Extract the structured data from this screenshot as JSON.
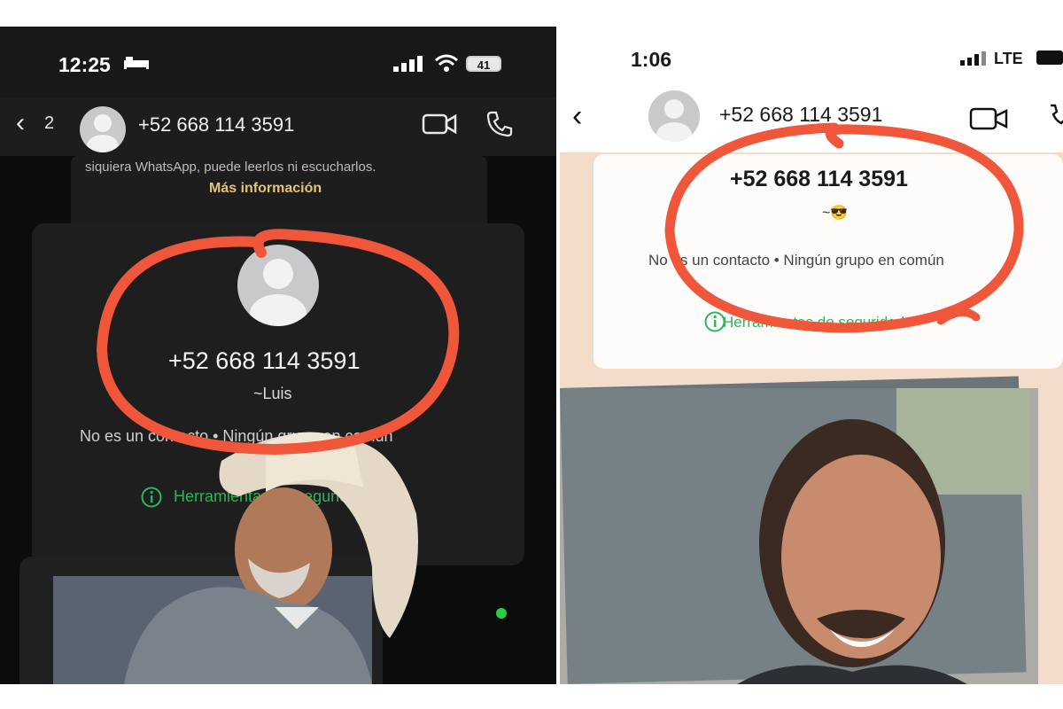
{
  "left": {
    "status": {
      "time": "12:25",
      "battery": "41"
    },
    "header": {
      "back_count": "2",
      "phone": "+52 668 114 3591"
    },
    "notice": {
      "text": "siquiera WhatsApp, puede leerlos ni escucharlos.",
      "link": "Más información"
    },
    "card": {
      "phone": "+52 668 114 3591",
      "name": "~Luis",
      "info": "No es un contacto • Ningún grupo en común",
      "tools_label": "Herramientas de seguridad"
    },
    "colors": {
      "highlight": "#f0563a",
      "accent_green": "#2db45c",
      "link_gold": "#e3c27b"
    }
  },
  "right": {
    "status": {
      "time": "1:06",
      "network": "LTE"
    },
    "header": {
      "phone": "+52 668 114 3591"
    },
    "card": {
      "phone": "+52 668 114 3591",
      "name": "~😎",
      "info": "No es un contacto • Ningún grupo en común",
      "tools_label": "Herramientas de seguridad"
    },
    "colors": {
      "highlight": "#f0563a",
      "accent_green": "#2db45c"
    }
  }
}
